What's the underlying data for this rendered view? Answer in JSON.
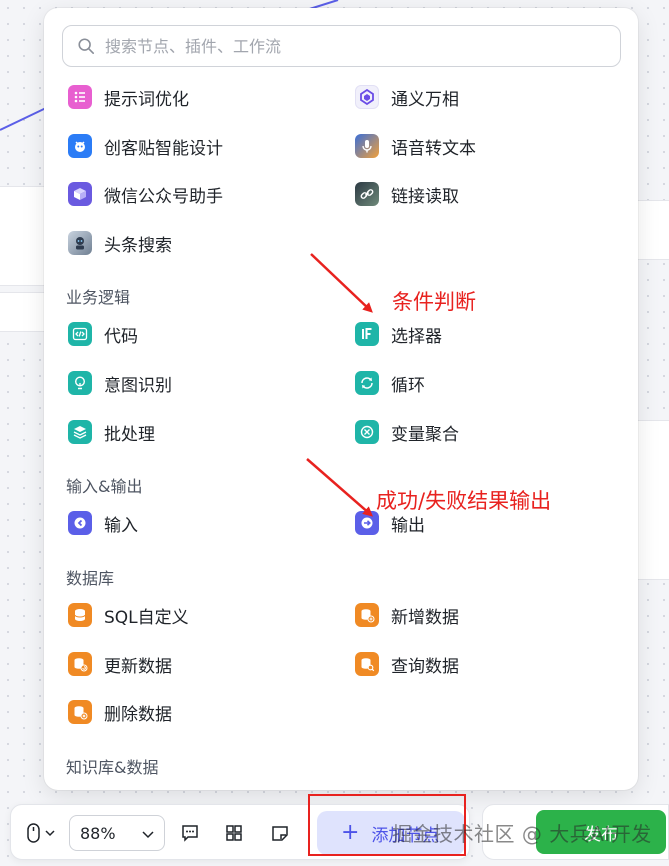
{
  "search": {
    "placeholder": "搜索节点、插件、工作流"
  },
  "items": [
    {
      "id": "prompt-optimize",
      "label": "提示词优化",
      "icon": "list-icon",
      "color": "#e85fd0"
    },
    {
      "id": "tongyi-wanxiang",
      "label": "通义万相",
      "icon": "tongyi-logo-icon",
      "color": "#6b4de6"
    },
    {
      "id": "chuangketie",
      "label": "创客贴智能设计",
      "icon": "chuangketie-logo-icon",
      "color": "#2b7cf6"
    },
    {
      "id": "speech-to-text",
      "label": "语音转文本",
      "icon": "microphone-icon",
      "color": "#3a6fd8"
    },
    {
      "id": "wechat-assistant",
      "label": "微信公众号助手",
      "icon": "cube-icon",
      "color": "#6a5ae0"
    },
    {
      "id": "link-reader",
      "label": "链接读取",
      "icon": "link-reader-icon",
      "color": "#4b5563"
    },
    {
      "id": "toutiao-search",
      "label": "头条搜索",
      "icon": "robot-icon",
      "color": "#7a8799"
    },
    {
      "id": "code",
      "label": "代码",
      "icon": "code-icon",
      "color": "#1fb5a8"
    },
    {
      "id": "selector",
      "label": "选择器",
      "icon": "if-icon",
      "color": "#1fb5a8"
    },
    {
      "id": "intent",
      "label": "意图识别",
      "icon": "bulb-icon",
      "color": "#1fb5a8"
    },
    {
      "id": "loop",
      "label": "循环",
      "icon": "loop-icon",
      "color": "#1fb5a8"
    },
    {
      "id": "batch",
      "label": "批处理",
      "icon": "layers-icon",
      "color": "#1fb5a8"
    },
    {
      "id": "var-merge",
      "label": "变量聚合",
      "icon": "merge-icon",
      "color": "#1fb5a8"
    },
    {
      "id": "input",
      "label": "输入",
      "icon": "input-icon",
      "color": "#5b5fe8"
    },
    {
      "id": "output",
      "label": "输出",
      "icon": "output-icon",
      "color": "#5b5fe8"
    },
    {
      "id": "sql",
      "label": "SQL自定义",
      "icon": "database-icon",
      "color": "#f08a24"
    },
    {
      "id": "db-add",
      "label": "新增数据",
      "icon": "database-plus-icon",
      "color": "#f08a24"
    },
    {
      "id": "db-update",
      "label": "更新数据",
      "icon": "database-update-icon",
      "color": "#f08a24"
    },
    {
      "id": "db-query",
      "label": "查询数据",
      "icon": "database-search-icon",
      "color": "#f08a24"
    },
    {
      "id": "db-delete",
      "label": "删除数据",
      "icon": "database-delete-icon",
      "color": "#f08a24"
    }
  ],
  "sections": {
    "business_logic": "业务逻辑",
    "io": "输入&输出",
    "database": "数据库",
    "knowledge": "知识库&数据"
  },
  "annotations": {
    "condition": "条件判断",
    "result": "成功/失败结果输出"
  },
  "toolbar": {
    "zoom": "88%",
    "add_label": "添加节点",
    "publish_label": "发布"
  },
  "watermark": "掘金技术社区 @ 大兵AI开发"
}
